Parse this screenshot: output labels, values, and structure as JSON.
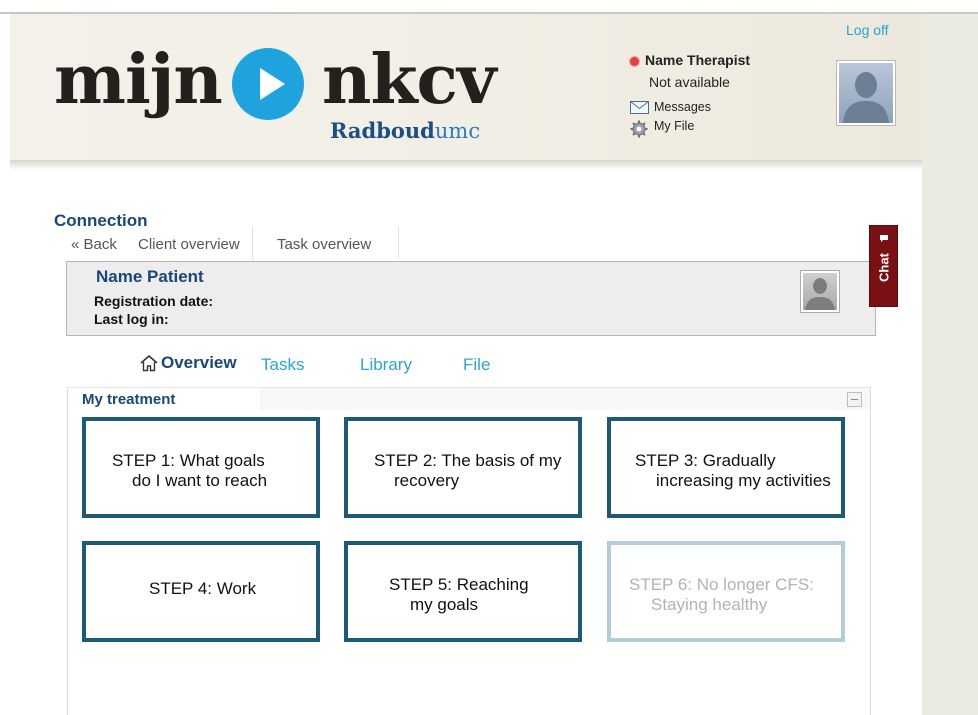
{
  "header": {
    "logo": {
      "left_word": "mijn",
      "right_word": "nkcv",
      "sub_word_1": "Radboud",
      "sub_word_2": "umc"
    },
    "logoff_label": "Log off",
    "therapist": {
      "name": "Name Therapist",
      "status": "Not available"
    },
    "links": {
      "messages": "Messages",
      "my_file": "My File"
    },
    "icons": {
      "status": "status-dot-icon",
      "messages": "envelope-icon",
      "my_file": "gear-icon",
      "avatar": "user-silhouette-icon"
    }
  },
  "breadcrumb": {
    "title": "Connection",
    "tabs": [
      {
        "label": "« Back"
      },
      {
        "label": "Client overview"
      },
      {
        "label": "Task overview"
      }
    ]
  },
  "patient": {
    "name": "Name Patient",
    "registration_label": "Registration date:",
    "last_login_label": "Last log in:"
  },
  "chat": {
    "label": "Chat",
    "icon": "speech-bubble-icon"
  },
  "nav": {
    "overview": "Overview",
    "tasks": "Tasks",
    "library": "Library",
    "file": "File",
    "home_icon": "home-icon"
  },
  "treatment": {
    "title": "My treatment",
    "steps": [
      {
        "line1": "STEP 1: What goals",
        "line2": "do I want to reach",
        "enabled": true
      },
      {
        "line1": "STEP 2: The basis of my",
        "line2": "recovery",
        "enabled": true
      },
      {
        "line1": "STEP 3: Gradually",
        "line2": "increasing my activities",
        "enabled": true
      },
      {
        "line1": "STEP 4: Work",
        "line2": "",
        "enabled": true
      },
      {
        "line1": "STEP 5: Reaching",
        "line2": "my goals",
        "enabled": true
      },
      {
        "line1": "STEP 6: No longer CFS:",
        "line2": "Staying healthy",
        "enabled": false
      }
    ]
  },
  "colors": {
    "brand_blue": "#1a4779",
    "logo_play": "#1ea3de",
    "link_cyan": "#2ca3d8",
    "step_border": "#1d5a78",
    "step_border_disabled": "#b1cdd8",
    "chat_tab": "#7a1014"
  }
}
